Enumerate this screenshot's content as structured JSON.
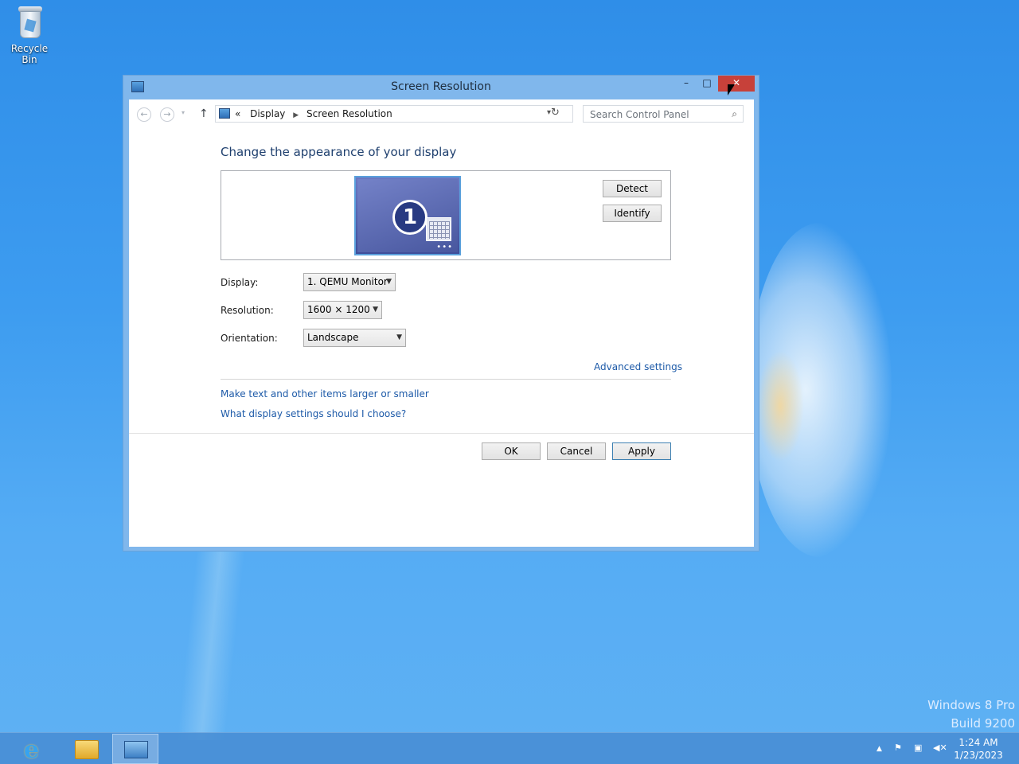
{
  "desktop": {
    "recycle_bin_label": "Recycle Bin",
    "watermark_line1": "Windows 8 Pro",
    "watermark_line2": "Build 9200"
  },
  "window": {
    "title": "Screen Resolution",
    "controls": {
      "minimize": "–",
      "maximize": "□",
      "close": "✕"
    },
    "address": {
      "overflow": "«",
      "crumbs": [
        "Display",
        "Screen Resolution"
      ]
    },
    "search_placeholder": "Search Control Panel"
  },
  "content": {
    "heading": "Change the appearance of your display",
    "monitor_number": "1",
    "detect_button": "Detect",
    "identify_button": "Identify",
    "display_label": "Display:",
    "display_value": "1. QEMU Monitor",
    "resolution_label": "Resolution:",
    "resolution_value": "1600 × 1200",
    "orientation_label": "Orientation:",
    "orientation_value": "Landscape",
    "advanced_link": "Advanced settings",
    "link_text_size": "Make text and other items larger or smaller",
    "link_help": "What display settings should I choose?",
    "ok_button": "OK",
    "cancel_button": "Cancel",
    "apply_button": "Apply"
  },
  "taskbar": {
    "clock_time": "1:24 AM",
    "clock_date": "1/23/2023"
  },
  "icons": [
    "recycle-bin-icon",
    "monitor-icon",
    "back-arrow-icon",
    "forward-arrow-icon",
    "up-arrow-icon",
    "refresh-icon",
    "search-icon",
    "ie-icon",
    "folder-icon",
    "control-panel-icon",
    "flag-icon",
    "network-icon",
    "volume-muted-icon"
  ]
}
